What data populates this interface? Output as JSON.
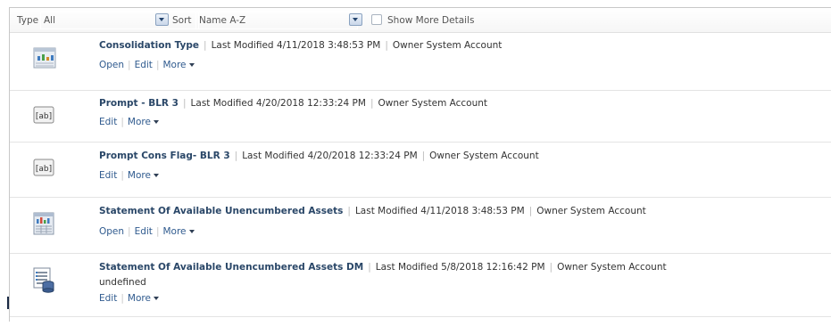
{
  "toolbar": {
    "type_label": "Type",
    "type_value": "All",
    "sort_label": "Sort",
    "sort_value": "Name A-Z",
    "show_more_label": "Show More Details"
  },
  "labels": {
    "last_modified": "Last Modified",
    "owner": "Owner",
    "open": "Open",
    "edit": "Edit",
    "more": "More"
  },
  "items": [
    {
      "title": "Consolidation Type",
      "last_modified": "4/11/2018 3:48:53 PM",
      "owner": "System Account",
      "icon": "report-grid-icon",
      "actions": [
        "open",
        "edit",
        "more"
      ]
    },
    {
      "title": "Prompt - BLR 3",
      "last_modified": "4/20/2018 12:33:24 PM",
      "owner": "System Account",
      "icon": "prompt-ab-icon",
      "actions": [
        "edit",
        "more"
      ]
    },
    {
      "title": "Prompt Cons Flag- BLR 3",
      "last_modified": "4/20/2018 12:33:24 PM",
      "owner": "System Account",
      "icon": "prompt-ab-icon",
      "actions": [
        "edit",
        "more"
      ]
    },
    {
      "title": "Statement Of Available Unencumbered Assets",
      "last_modified": "4/11/2018 3:48:53 PM",
      "owner": "System Account",
      "icon": "report-chart-icon",
      "actions": [
        "open",
        "edit",
        "more"
      ]
    },
    {
      "title": "Statement Of Available Unencumbered Assets DM",
      "last_modified": "5/8/2018 12:16:42 PM",
      "owner": "System Account",
      "subtitle": "undefined",
      "icon": "data-model-icon",
      "actions": [
        "edit",
        "more"
      ]
    }
  ]
}
